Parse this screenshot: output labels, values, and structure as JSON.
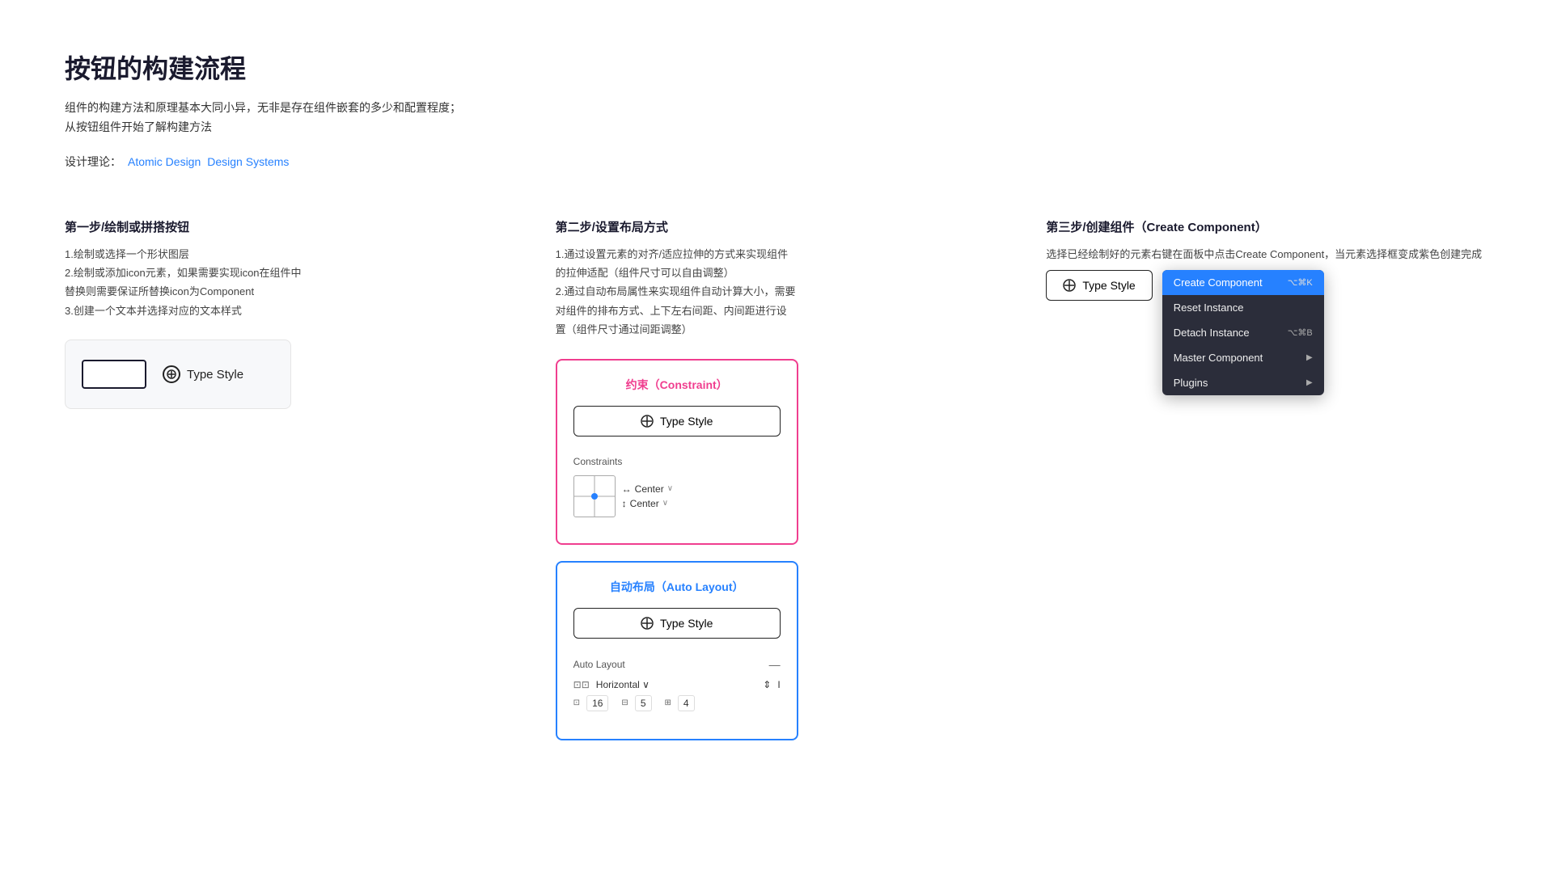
{
  "page": {
    "title": "按钮的构建流程",
    "description": "组件的构建方法和原理基本大同小异，无非是存在组件嵌套的多少和配置程度；从按钮组件开始了解构建方法",
    "theory_label": "设计理论：",
    "theory_links": [
      {
        "label": "Atomic Design",
        "url": "#"
      },
      {
        "label": "Design Systems",
        "url": "#"
      }
    ]
  },
  "step1": {
    "title": "第一步/绘制或拼搭按钮",
    "desc_lines": [
      "1.绘制或选择一个形状图层",
      "2.绘制或添加icon元素，如果需要实现icon在组件中替换则需要保证所替换icon为Component",
      "3.创建一个文本并选择对应的文本样式"
    ],
    "button_label": "Type Style",
    "icon_symbol": "⊕"
  },
  "step2": {
    "title": "第二步/设置布局方式",
    "desc_lines": [
      "1.通过设置元素的对齐/适应拉伸的方式来实现组件的拉伸适配（组件尺寸可以自由调整）",
      "2.通过自动布局属性来实现组件自动计算大小，需要对组件的排布方式、上下左右间距、内间距进行设置（组件尺寸通过间距调整）"
    ],
    "constraint_title": "约束（Constraint）",
    "constraint_btn": "Type Style",
    "constraint_panel_label": "Constraints",
    "constraint_h": "Center",
    "constraint_v": "Center",
    "autolayout_title": "自动布局（Auto Layout）",
    "autolayout_btn": "Type Style",
    "autolayout_panel_label": "Auto Layout",
    "autolayout_direction": "Horizontal",
    "autolayout_values": [
      {
        "icon": "⊡",
        "value": "16"
      },
      {
        "icon": "⊟",
        "value": "5"
      },
      {
        "icon": "⊞",
        "value": "4"
      }
    ]
  },
  "step3": {
    "title": "第三步/创建组件（Create Component）",
    "desc": "选择已经绘制好的元素右键在面板中点击Create Component，当元素选择框变成紫色创建完成",
    "button_label": "Type Style",
    "icon_symbol": "⊕",
    "menu_items": [
      {
        "label": "Create Component",
        "shortcut": "⌥⌘K",
        "active": true,
        "has_arrow": false
      },
      {
        "label": "Reset Instance",
        "shortcut": "",
        "active": false,
        "has_arrow": false
      },
      {
        "label": "Detach Instance",
        "shortcut": "⌥⌘B",
        "active": false,
        "has_arrow": false
      },
      {
        "label": "Master Component",
        "shortcut": "",
        "active": false,
        "has_arrow": true
      },
      {
        "label": "Plugins",
        "shortcut": "",
        "active": false,
        "has_arrow": true
      }
    ]
  }
}
